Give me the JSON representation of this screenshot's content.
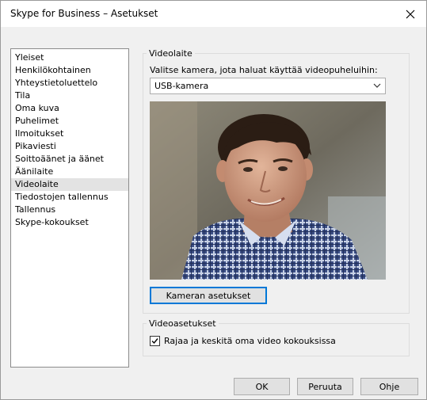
{
  "window": {
    "title": "Skype for Business – Asetukset"
  },
  "nav": {
    "items": [
      {
        "label": "Yleiset"
      },
      {
        "label": "Henkilökohtainen"
      },
      {
        "label": "Yhteystietoluettelo"
      },
      {
        "label": "Tila"
      },
      {
        "label": "Oma kuva"
      },
      {
        "label": "Puhelimet"
      },
      {
        "label": "Ilmoitukset"
      },
      {
        "label": "Pikaviesti"
      },
      {
        "label": "Soittoäänet ja äänet"
      },
      {
        "label": "Äänilaite"
      },
      {
        "label": "Videolaite"
      },
      {
        "label": "Tiedostojen tallennus"
      },
      {
        "label": "Tallennus"
      },
      {
        "label": "Skype-kokoukset"
      }
    ],
    "selected": "Videolaite"
  },
  "video_device": {
    "group_label": "Videolaite",
    "instruction": "Valitse kamera, jota haluat käyttää videopuheluihin:",
    "camera_select_value": "USB-kamera",
    "camera_settings_button": "Kameran asetukset"
  },
  "video_settings": {
    "group_label": "Videoasetukset",
    "crop_center_label": "Rajaa ja keskitä oma video kokouksissa",
    "crop_center_checked": true
  },
  "footer": {
    "ok_label": "OK",
    "cancel_label": "Peruuta",
    "help_label": "Ohje"
  },
  "colors": {
    "window_bg": "#f0f0f0",
    "selection_bg": "#e3e3e3",
    "focus_border": "#0078d7"
  }
}
